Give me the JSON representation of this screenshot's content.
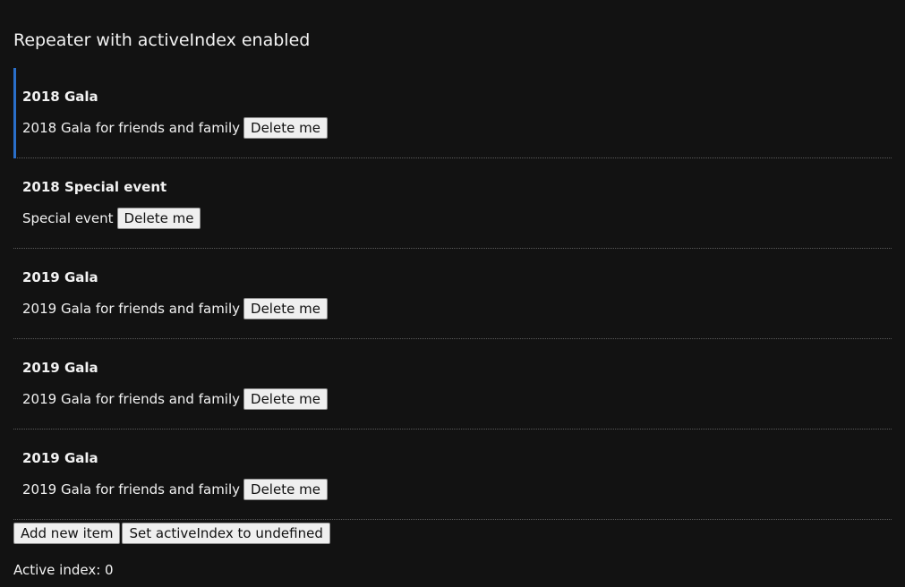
{
  "page": {
    "title": "Repeater with activeIndex enabled"
  },
  "items": [
    {
      "title": "2018 Gala",
      "description": "2018 Gala for friends and family",
      "button_label": "Delete me",
      "active": true
    },
    {
      "title": "2018 Special event",
      "description": "Special event",
      "button_label": "Delete me",
      "active": false
    },
    {
      "title": "2019 Gala",
      "description": "2019 Gala for friends and family",
      "button_label": "Delete me",
      "active": false
    },
    {
      "title": "2019 Gala",
      "description": "2019 Gala for friends and family",
      "button_label": "Delete me",
      "active": false
    },
    {
      "title": "2019 Gala",
      "description": "2019 Gala for friends and family",
      "button_label": "Delete me",
      "active": false
    }
  ],
  "controls": {
    "add_label": "Add new item",
    "reset_label": "Set activeIndex to undefined"
  },
  "status": {
    "active_index_text": "Active index: 0"
  },
  "colors": {
    "background": "#121212",
    "active_indicator": "#2a6fc9",
    "text": "#f2f2f2"
  }
}
